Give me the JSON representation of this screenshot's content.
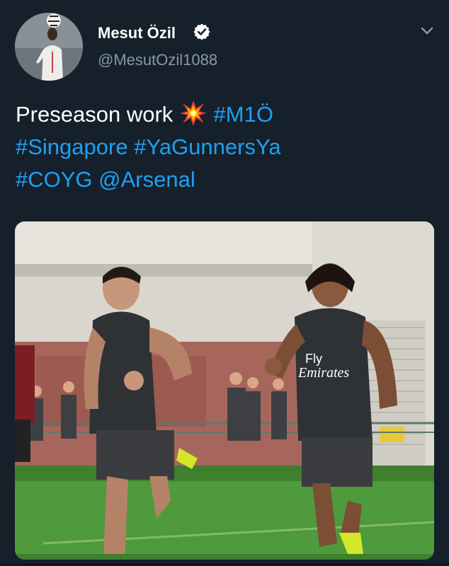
{
  "tweet": {
    "author": {
      "display_name": "Mesut Özil",
      "handle": "@MesutOzil1088",
      "verified": true,
      "verified_icon": "verified-badge-icon",
      "avatar": "profile-photo-juggling-ball"
    },
    "menu_icon": "chevron-down-icon",
    "text": {
      "plain": "Preseason work",
      "emoji": "collision-emoji",
      "hashtags": [
        "#M1Ö",
        "#Singapore",
        "#YaGunnersYa",
        "#COYG"
      ],
      "mention": "@Arsenal"
    },
    "photo": {
      "description_icon": "training-photo",
      "shirt_sponsor_lines": [
        "Fly",
        "Emirates"
      ]
    }
  },
  "colors": {
    "background": "#15202b",
    "text": "#ffffff",
    "secondary_text": "#8899a6",
    "link": "#1da1f2",
    "verified": "#ffffff"
  }
}
